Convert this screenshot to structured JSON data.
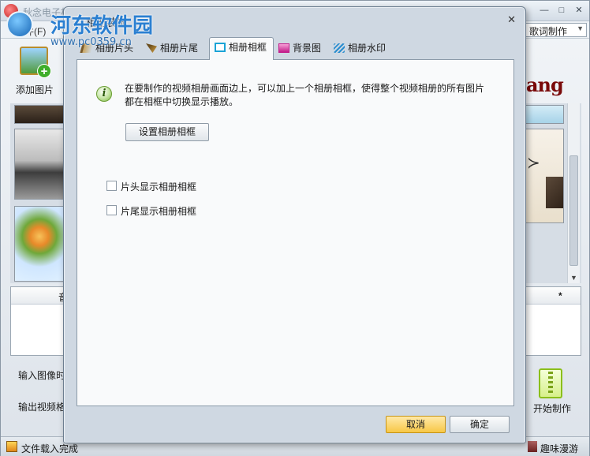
{
  "app": {
    "title": "秋念电子相册制作 - 视频相册制作",
    "file_menu": "文件(F)",
    "lyrics_select": "歌词制作",
    "add_picture": "添加图片",
    "brand_text": "ang",
    "list_column": "音",
    "list_star": "*",
    "input_time_label": "输入图像时",
    "output_format_label": "输出视频格",
    "start_make": "开始制作",
    "status": "文件载入完成",
    "fun_label": "趣味漫游",
    "minimize": "—",
    "maximize": "□",
    "close": "✕"
  },
  "watermark": {
    "title": "河东软件园",
    "url": "www.pc0359.cn"
  },
  "dialog": {
    "title": "相册装饰",
    "close": "✕",
    "tabs": [
      {
        "label": "相册片头",
        "icon": "header-flag-icon"
      },
      {
        "label": "相册片尾",
        "icon": "footer-flag-icon"
      },
      {
        "label": "相册相框",
        "icon": "frame-icon",
        "active": true
      },
      {
        "label": "背景图",
        "icon": "background-image-icon"
      },
      {
        "label": "相册水印",
        "icon": "watermark-icon"
      }
    ],
    "info_icon": "i",
    "info_text": "在要制作的视频相册画面边上，可以加上一个相册相框，使得整个视频相册的所有图片都在相框中切换显示播放。",
    "set_frame_button": "设置相册相框",
    "checkbox_header": "片头显示相册相框",
    "checkbox_footer": "片尾显示相册相框",
    "cancel_button": "取消",
    "ok_button": "确定"
  },
  "colors": {
    "accent_yellow": "#f7c746",
    "frame_tab_icon": "#1aa3d6"
  }
}
